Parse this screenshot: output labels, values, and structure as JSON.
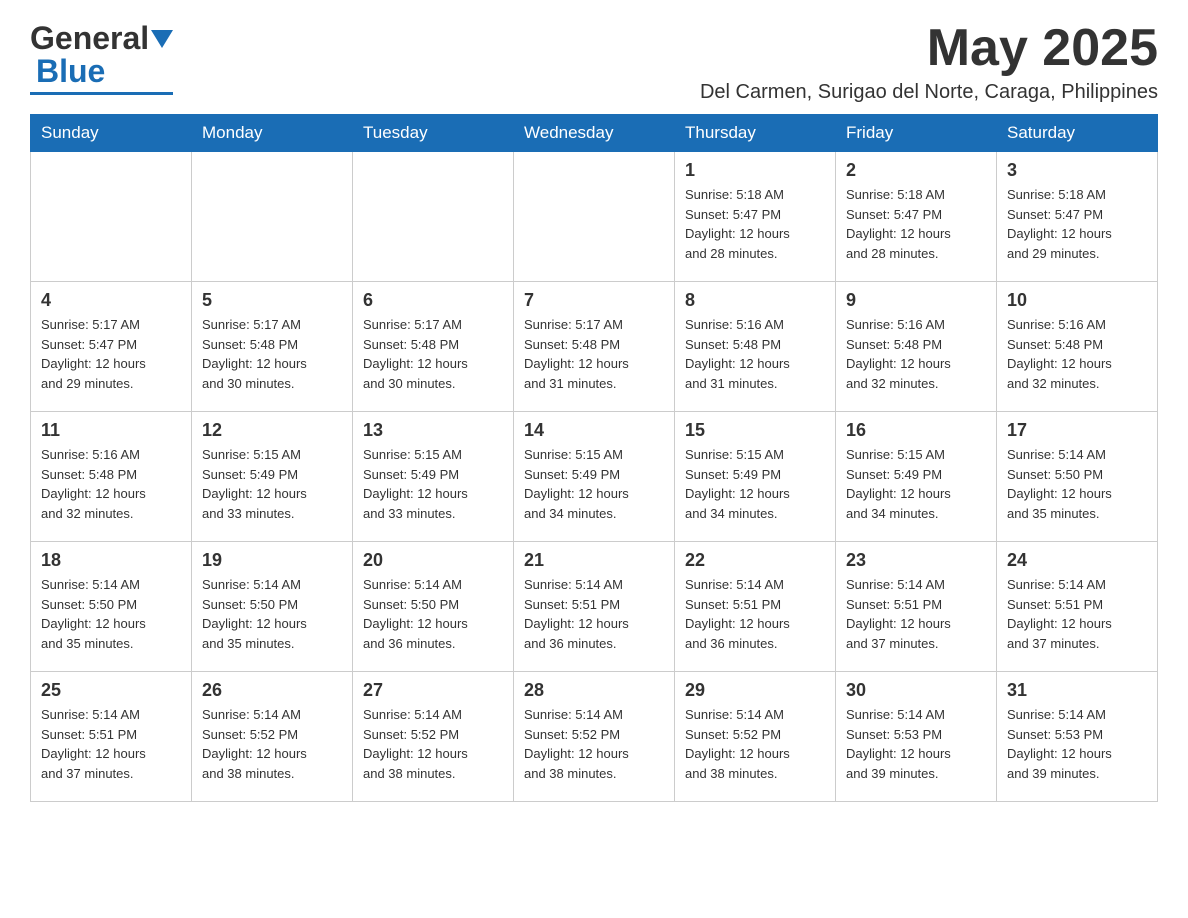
{
  "header": {
    "logo_general": "General",
    "logo_blue": "Blue",
    "title": "May 2025",
    "subtitle": "Del Carmen, Surigao del Norte, Caraga, Philippines"
  },
  "days_of_week": [
    "Sunday",
    "Monday",
    "Tuesday",
    "Wednesday",
    "Thursday",
    "Friday",
    "Saturday"
  ],
  "weeks": [
    [
      {
        "day": "",
        "info": ""
      },
      {
        "day": "",
        "info": ""
      },
      {
        "day": "",
        "info": ""
      },
      {
        "day": "",
        "info": ""
      },
      {
        "day": "1",
        "info": "Sunrise: 5:18 AM\nSunset: 5:47 PM\nDaylight: 12 hours\nand 28 minutes."
      },
      {
        "day": "2",
        "info": "Sunrise: 5:18 AM\nSunset: 5:47 PM\nDaylight: 12 hours\nand 28 minutes."
      },
      {
        "day": "3",
        "info": "Sunrise: 5:18 AM\nSunset: 5:47 PM\nDaylight: 12 hours\nand 29 minutes."
      }
    ],
    [
      {
        "day": "4",
        "info": "Sunrise: 5:17 AM\nSunset: 5:47 PM\nDaylight: 12 hours\nand 29 minutes."
      },
      {
        "day": "5",
        "info": "Sunrise: 5:17 AM\nSunset: 5:48 PM\nDaylight: 12 hours\nand 30 minutes."
      },
      {
        "day": "6",
        "info": "Sunrise: 5:17 AM\nSunset: 5:48 PM\nDaylight: 12 hours\nand 30 minutes."
      },
      {
        "day": "7",
        "info": "Sunrise: 5:17 AM\nSunset: 5:48 PM\nDaylight: 12 hours\nand 31 minutes."
      },
      {
        "day": "8",
        "info": "Sunrise: 5:16 AM\nSunset: 5:48 PM\nDaylight: 12 hours\nand 31 minutes."
      },
      {
        "day": "9",
        "info": "Sunrise: 5:16 AM\nSunset: 5:48 PM\nDaylight: 12 hours\nand 32 minutes."
      },
      {
        "day": "10",
        "info": "Sunrise: 5:16 AM\nSunset: 5:48 PM\nDaylight: 12 hours\nand 32 minutes."
      }
    ],
    [
      {
        "day": "11",
        "info": "Sunrise: 5:16 AM\nSunset: 5:48 PM\nDaylight: 12 hours\nand 32 minutes."
      },
      {
        "day": "12",
        "info": "Sunrise: 5:15 AM\nSunset: 5:49 PM\nDaylight: 12 hours\nand 33 minutes."
      },
      {
        "day": "13",
        "info": "Sunrise: 5:15 AM\nSunset: 5:49 PM\nDaylight: 12 hours\nand 33 minutes."
      },
      {
        "day": "14",
        "info": "Sunrise: 5:15 AM\nSunset: 5:49 PM\nDaylight: 12 hours\nand 34 minutes."
      },
      {
        "day": "15",
        "info": "Sunrise: 5:15 AM\nSunset: 5:49 PM\nDaylight: 12 hours\nand 34 minutes."
      },
      {
        "day": "16",
        "info": "Sunrise: 5:15 AM\nSunset: 5:49 PM\nDaylight: 12 hours\nand 34 minutes."
      },
      {
        "day": "17",
        "info": "Sunrise: 5:14 AM\nSunset: 5:50 PM\nDaylight: 12 hours\nand 35 minutes."
      }
    ],
    [
      {
        "day": "18",
        "info": "Sunrise: 5:14 AM\nSunset: 5:50 PM\nDaylight: 12 hours\nand 35 minutes."
      },
      {
        "day": "19",
        "info": "Sunrise: 5:14 AM\nSunset: 5:50 PM\nDaylight: 12 hours\nand 35 minutes."
      },
      {
        "day": "20",
        "info": "Sunrise: 5:14 AM\nSunset: 5:50 PM\nDaylight: 12 hours\nand 36 minutes."
      },
      {
        "day": "21",
        "info": "Sunrise: 5:14 AM\nSunset: 5:51 PM\nDaylight: 12 hours\nand 36 minutes."
      },
      {
        "day": "22",
        "info": "Sunrise: 5:14 AM\nSunset: 5:51 PM\nDaylight: 12 hours\nand 36 minutes."
      },
      {
        "day": "23",
        "info": "Sunrise: 5:14 AM\nSunset: 5:51 PM\nDaylight: 12 hours\nand 37 minutes."
      },
      {
        "day": "24",
        "info": "Sunrise: 5:14 AM\nSunset: 5:51 PM\nDaylight: 12 hours\nand 37 minutes."
      }
    ],
    [
      {
        "day": "25",
        "info": "Sunrise: 5:14 AM\nSunset: 5:51 PM\nDaylight: 12 hours\nand 37 minutes."
      },
      {
        "day": "26",
        "info": "Sunrise: 5:14 AM\nSunset: 5:52 PM\nDaylight: 12 hours\nand 38 minutes."
      },
      {
        "day": "27",
        "info": "Sunrise: 5:14 AM\nSunset: 5:52 PM\nDaylight: 12 hours\nand 38 minutes."
      },
      {
        "day": "28",
        "info": "Sunrise: 5:14 AM\nSunset: 5:52 PM\nDaylight: 12 hours\nand 38 minutes."
      },
      {
        "day": "29",
        "info": "Sunrise: 5:14 AM\nSunset: 5:52 PM\nDaylight: 12 hours\nand 38 minutes."
      },
      {
        "day": "30",
        "info": "Sunrise: 5:14 AM\nSunset: 5:53 PM\nDaylight: 12 hours\nand 39 minutes."
      },
      {
        "day": "31",
        "info": "Sunrise: 5:14 AM\nSunset: 5:53 PM\nDaylight: 12 hours\nand 39 minutes."
      }
    ]
  ]
}
